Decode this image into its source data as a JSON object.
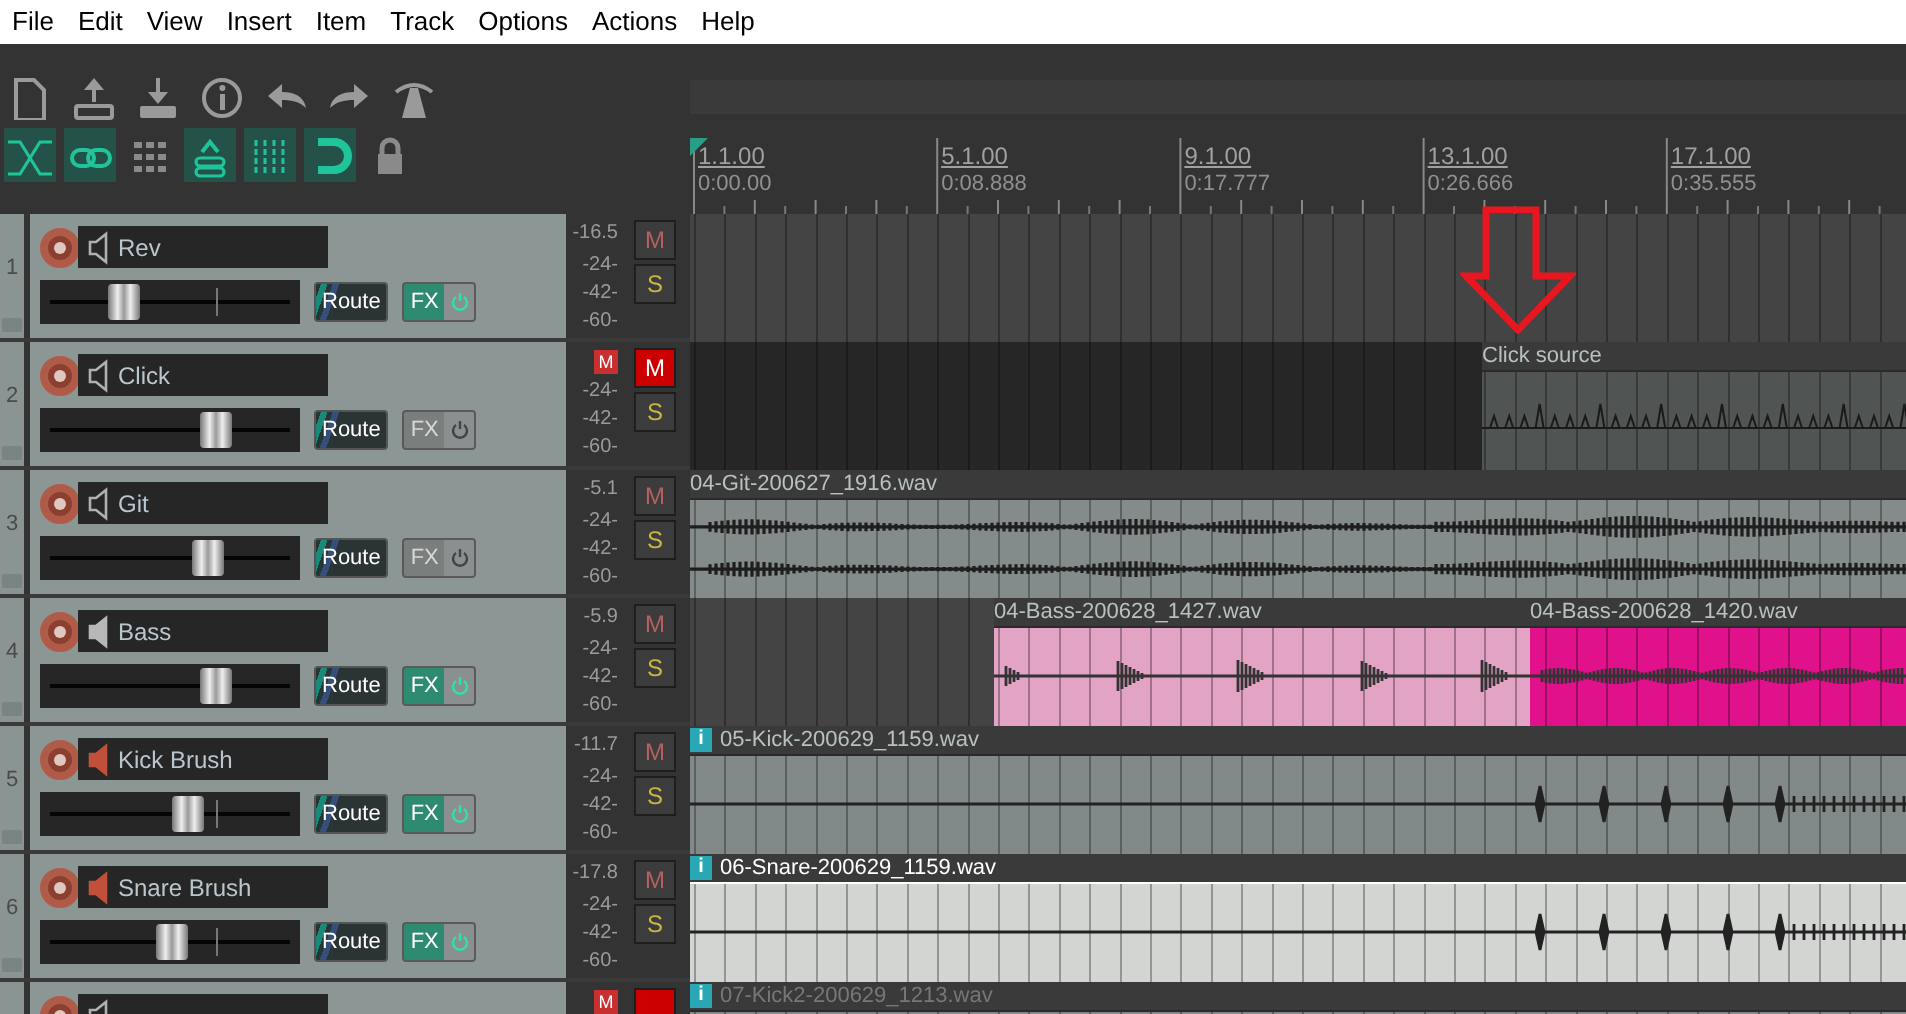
{
  "menu": [
    "File",
    "Edit",
    "View",
    "Insert",
    "Item",
    "Track",
    "Options",
    "Actions",
    "Help"
  ],
  "toolbar": {
    "toggles": [
      {
        "on": true
      },
      {
        "on": true
      },
      {
        "on": false
      },
      {
        "on": true
      },
      {
        "on": true
      },
      {
        "on": true
      },
      {
        "on": false
      }
    ]
  },
  "ruler": [
    {
      "bar": "1.1.00",
      "time": "0:00.00"
    },
    {
      "bar": "5.1.00",
      "time": "0:08.888"
    },
    {
      "bar": "9.1.00",
      "time": "0:17.777"
    },
    {
      "bar": "13.1.00",
      "time": "0:26.666"
    },
    {
      "bar": "17.1.00",
      "time": "0:35.555"
    }
  ],
  "tracks": [
    {
      "number": "1",
      "name": "Rev",
      "speaker": {
        "filled": false,
        "color": "#b0b0b0"
      },
      "level": 0.3,
      "peak": "-16.5",
      "meter_scale": [
        "-24-",
        "-42-",
        "-60-"
      ],
      "muted": false,
      "fx_enabled": true,
      "mute_label": "M",
      "solo_label": "S",
      "route_label": "Route",
      "fx_label": "FX"
    },
    {
      "number": "2",
      "name": "Click",
      "speaker": {
        "filled": false,
        "color": "#b0b0b0"
      },
      "level": 0.71,
      "mute_indicator": "M",
      "meter_scale": [
        "-24-",
        "-42-",
        "-60-"
      ],
      "muted": true,
      "fx_enabled": false,
      "mute_label": "M",
      "solo_label": "S",
      "route_label": "Route",
      "fx_label": "FX",
      "clips": [
        {
          "name": "Click source",
          "color": "#505453",
          "kind": "click"
        }
      ]
    },
    {
      "number": "3",
      "name": "Git",
      "speaker": {
        "filled": false,
        "color": "#b0b0b0"
      },
      "level": 0.68,
      "peak": "-5.1",
      "meter_scale": [
        "-24-",
        "-42-",
        "-60-"
      ],
      "muted": false,
      "fx_enabled": false,
      "mute_label": "M",
      "solo_label": "S",
      "route_label": "Route",
      "fx_label": "FX",
      "clips": [
        {
          "name": "04-Git-200627_1916.wav",
          "color": "#838c8a",
          "kind": "stereo"
        }
      ]
    },
    {
      "number": "4",
      "name": "Bass",
      "speaker": {
        "filled": true,
        "color": "#b8b8b8"
      },
      "level": 0.71,
      "peak": "-5.9",
      "meter_scale": [
        "-24-",
        "-42-",
        "-60-"
      ],
      "muted": false,
      "fx_enabled": true,
      "mute_label": "M",
      "solo_label": "S",
      "route_label": "Route",
      "fx_label": "FX",
      "clips": [
        {
          "name": "04-Bass-200628_1427.wav",
          "color": "#e2a3c4",
          "kind": "mono"
        },
        {
          "name": "04-Bass-200628_1420.wav",
          "color": "#e0118b",
          "kind": "mono"
        }
      ]
    },
    {
      "number": "5",
      "name": "Kick Brush",
      "speaker": {
        "filled": true,
        "color": "#c0503a"
      },
      "level": 0.59,
      "peak": "-11.7",
      "meter_scale": [
        "-24-",
        "-42-",
        "-60-"
      ],
      "muted": false,
      "fx_enabled": true,
      "mute_label": "M",
      "solo_label": "S",
      "route_label": "Route",
      "fx_label": "FX",
      "clips": [
        {
          "name": "05-Kick-200629_1159.wav",
          "color": "#818a88",
          "kind": "hits",
          "badge": "i"
        }
      ]
    },
    {
      "number": "6",
      "name": "Snare Brush",
      "speaker": {
        "filled": true,
        "color": "#c0503a"
      },
      "level": 0.52,
      "peak": "-17.8",
      "meter_scale": [
        "-24-",
        "-42-",
        "-60-"
      ],
      "muted": false,
      "fx_enabled": true,
      "mute_label": "M",
      "solo_label": "S",
      "route_label": "Route",
      "fx_label": "FX",
      "clips": [
        {
          "name": "06-Snare-200629_1159.wav",
          "color": "#d3d5d3",
          "kind": "hits",
          "badge": "i",
          "selected": true
        }
      ]
    },
    {
      "speaker": {
        "filled": false,
        "color": "#b0b0b0"
      },
      "mute_indicator": "M",
      "muted": true,
      "clips": [
        {
          "name": "07-Kick2-200629_1213.wav",
          "kind": "hits",
          "badge": "i",
          "selected": false
        }
      ]
    }
  ]
}
